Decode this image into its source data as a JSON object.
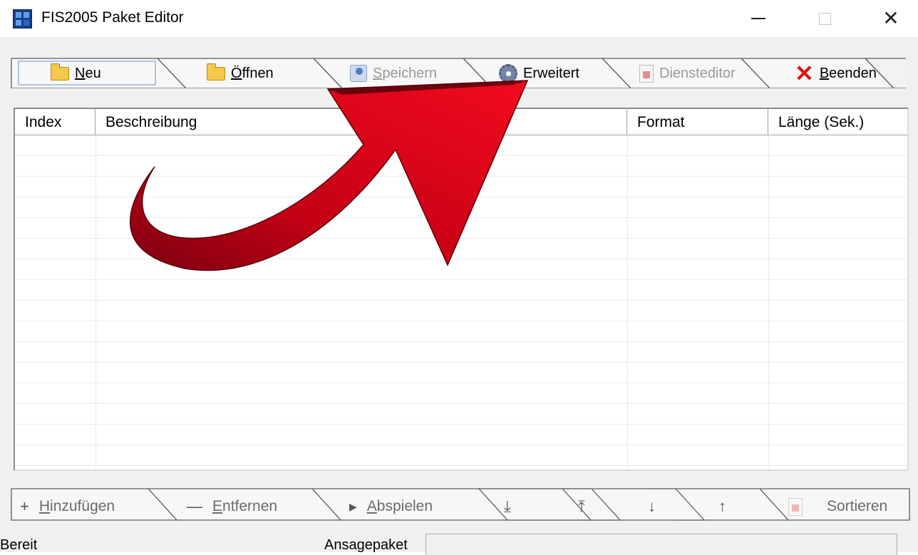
{
  "window": {
    "title": "FIS2005 Paket Editor",
    "minimize_glyph": "—",
    "close_glyph": "✕"
  },
  "toolbar": {
    "tabs": [
      {
        "prefix": "",
        "mnemonic": "N",
        "rest": "eu",
        "icon": "new-folder-icon",
        "enabled": true
      },
      {
        "prefix": "",
        "mnemonic": "Ö",
        "rest": "ffnen",
        "icon": "folder-icon",
        "enabled": true
      },
      {
        "prefix": "",
        "mnemonic": "S",
        "rest": "peichern",
        "icon": "save-icon",
        "enabled": false
      },
      {
        "prefix": "",
        "mnemonic": "",
        "rest": "Erweitert",
        "icon": "gear-icon",
        "enabled": true
      },
      {
        "prefix": "",
        "mnemonic": "",
        "rest": "Diensteditor",
        "icon": "document-icon",
        "enabled": false
      },
      {
        "prefix": "",
        "mnemonic": "B",
        "rest": "eenden",
        "icon": "close-icon",
        "enabled": true
      }
    ]
  },
  "list": {
    "columns": [
      "Index",
      "Beschreibung",
      "Format",
      "Länge (Sek.)"
    ],
    "rows": []
  },
  "bottombar": {
    "buttons": [
      {
        "glyph": "+",
        "mnemonic": "H",
        "rest": "inzufügen",
        "icon": "plus-icon"
      },
      {
        "glyph": "—",
        "mnemonic": "E",
        "rest": "ntfernen",
        "icon": "minus-icon"
      },
      {
        "glyph": "▶",
        "mnemonic": "A",
        "rest": "bspielen",
        "icon": "play-icon"
      },
      {
        "glyph": "⤓",
        "mnemonic": "",
        "rest": "",
        "icon": "move-to-bottom-icon"
      },
      {
        "glyph": "⤒",
        "mnemonic": "",
        "rest": "",
        "icon": "move-to-top-icon"
      },
      {
        "glyph": "↓",
        "mnemonic": "",
        "rest": "",
        "icon": "move-down-icon"
      },
      {
        "glyph": "↑",
        "mnemonic": "",
        "rest": "",
        "icon": "move-up-icon"
      },
      {
        "glyph": "",
        "mnemonic": "",
        "rest": "Sortieren",
        "icon": "sort-document-icon"
      }
    ]
  },
  "status": {
    "text": "Bereit",
    "package_label": "Ansagepaket",
    "package_value": ""
  },
  "colors": {
    "annotation_arrow": "#d7081b"
  }
}
